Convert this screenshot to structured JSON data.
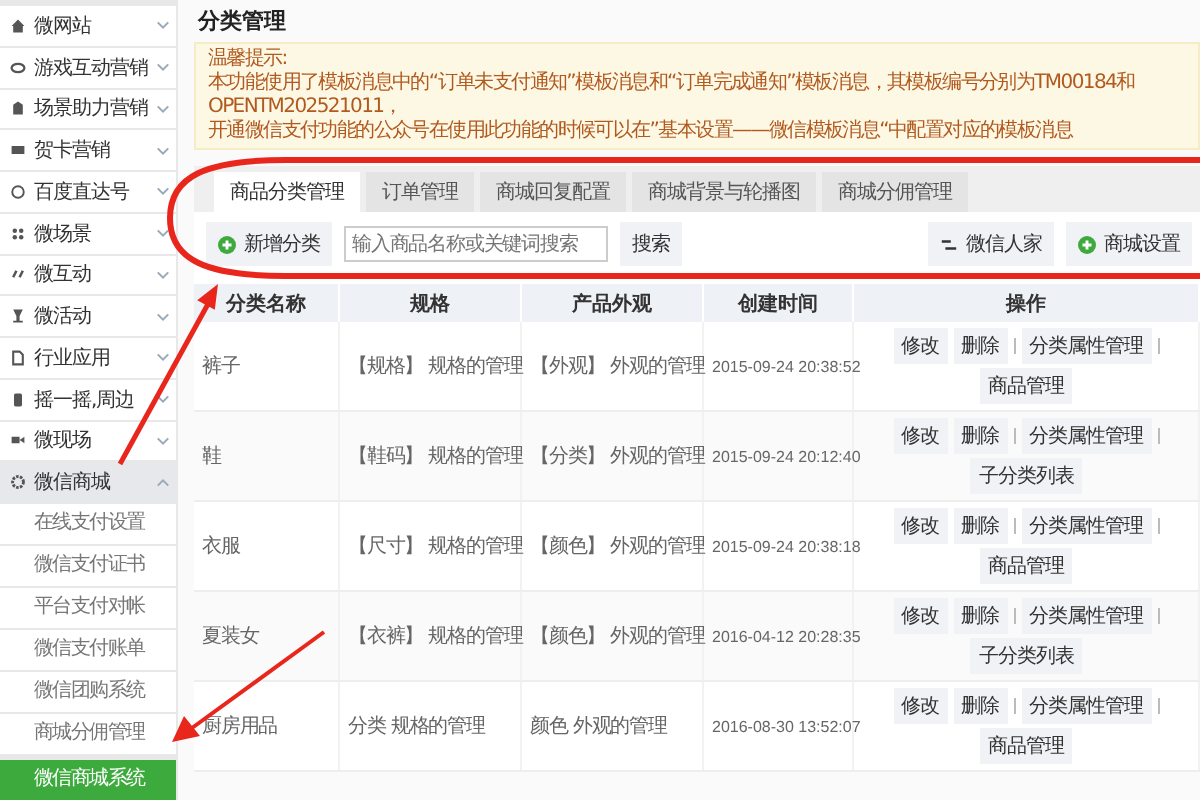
{
  "sidebar": {
    "items": [
      {
        "label": "微网站",
        "expanded": false
      },
      {
        "label": "游戏互动营销",
        "expanded": false
      },
      {
        "label": "场景助力营销",
        "expanded": false
      },
      {
        "label": "贺卡营销",
        "expanded": false
      },
      {
        "label": "百度直达号",
        "expanded": false
      },
      {
        "label": "微场景",
        "expanded": false
      },
      {
        "label": "微互动",
        "expanded": false
      },
      {
        "label": "微活动",
        "expanded": false
      },
      {
        "label": "行业应用",
        "expanded": false
      },
      {
        "label": "摇一摇,周边",
        "expanded": false
      },
      {
        "label": "微现场",
        "expanded": false
      },
      {
        "label": "微信商城",
        "expanded": true,
        "children": [
          {
            "label": "在线支付设置",
            "selected": false
          },
          {
            "label": "微信支付证书",
            "selected": false
          },
          {
            "label": "平台支付对帐",
            "selected": false
          },
          {
            "label": "微信支付账单",
            "selected": false
          },
          {
            "label": "微信团购系统",
            "selected": false
          },
          {
            "label": "商城分佣管理",
            "selected": false
          },
          {
            "label": "微信商城系统",
            "selected": true
          }
        ]
      }
    ]
  },
  "page_title": "分类管理",
  "notice": {
    "heading": "温馨提示:",
    "lines": [
      "本功能使用了模板消息中的“订单未支付通知”模板消息和“订单完成通知”模板消息，其模板编号分别为TM00184和OPENTM202521011，",
      "开通微信支付功能的公众号在使用此功能的时候可以在”基本设置——微信模板消息“中配置对应的模板消息"
    ]
  },
  "tabs": [
    {
      "label": "商品分类管理",
      "selected": true
    },
    {
      "label": "订单管理",
      "selected": false
    },
    {
      "label": "商城回复配置",
      "selected": false
    },
    {
      "label": "商城背景与轮播图",
      "selected": false
    },
    {
      "label": "商城分佣管理",
      "selected": false
    }
  ],
  "toolbar": {
    "add_button": "新增分类",
    "search": {
      "placeholder": "输入商品名称或关键词搜索"
    },
    "search_button": "搜索",
    "right_buttons": [
      {
        "label": "微信人家",
        "kind": "lines"
      },
      {
        "label": "商城设置",
        "kind": "plus"
      }
    ]
  },
  "table": {
    "columns": [
      "分类名称",
      "规格",
      "产品外观",
      "创建时间",
      "操作"
    ],
    "rows": [
      {
        "name": "裤子",
        "spec": "【规格】 规格的管理",
        "look": "【外观】 外观的管理",
        "created": "2015-09-24 20:38:52",
        "actions": [
          "修改",
          "删除",
          "分类属性管理"
        ],
        "extra": "商品管理"
      },
      {
        "name": "鞋",
        "spec": "【鞋码】 规格的管理",
        "look": "【分类】 外观的管理",
        "created": "2015-09-24 20:12:40",
        "actions": [
          "修改",
          "删除",
          "分类属性管理"
        ],
        "extra": "子分类列表"
      },
      {
        "name": "衣服",
        "spec": "【尺寸】 规格的管理",
        "look": "【颜色】 外观的管理",
        "created": "2015-09-24 20:38:18",
        "actions": [
          "修改",
          "删除",
          "分类属性管理"
        ],
        "extra": "商品管理"
      },
      {
        "name": "夏装女",
        "spec": "【衣裤】 规格的管理",
        "look": "【颜色】 外观的管理",
        "created": "2016-04-12 20:28:35",
        "actions": [
          "修改",
          "删除",
          "分类属性管理"
        ],
        "extra": "子分类列表"
      },
      {
        "name": "厨房用品",
        "spec": "分类 规格的管理",
        "look": "颜色 外观的管理",
        "created": "2016-08-30 13:52:07",
        "actions": [
          "修改",
          "删除",
          "分类属性管理"
        ],
        "extra": "商品管理"
      }
    ]
  }
}
